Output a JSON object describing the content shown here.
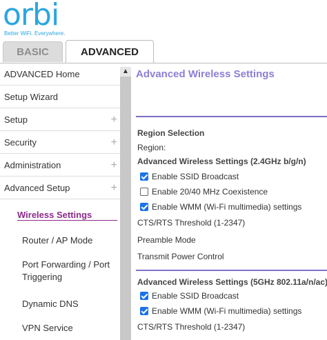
{
  "brand": {
    "name": "orbi",
    "tagline": "Better WiFi. Everywhere.",
    "color": "#2aa6e0"
  },
  "tabs": {
    "basic": "BASIC",
    "advanced": "ADVANCED"
  },
  "sidebar": {
    "items": [
      {
        "label": "ADVANCED Home",
        "icon": "chevron-up"
      },
      {
        "label": "Setup Wizard"
      },
      {
        "label": "Setup",
        "icon": "plus"
      },
      {
        "label": "Security",
        "icon": "plus"
      },
      {
        "label": "Administration",
        "icon": "plus"
      },
      {
        "label": "Advanced Setup",
        "icon": "plus"
      }
    ],
    "sub_items": [
      "Wireless Settings",
      "Router / AP Mode",
      "Port Forwarding / Port Triggering",
      "Dynamic DNS",
      "VPN Service"
    ]
  },
  "content": {
    "title": "Advanced Wireless Settings",
    "region_heading": "Region Selection",
    "region_label": "Region:",
    "section_24": {
      "heading": "Advanced Wireless Settings (2.4GHz b/g/n)",
      "checkboxes": [
        {
          "label": "Enable SSID Broadcast",
          "checked": true
        },
        {
          "label": "Enable 20/40 MHz Coexistence",
          "checked": false
        },
        {
          "label": "Enable WMM (Wi-Fi multimedia) settings",
          "checked": true
        }
      ],
      "cts_label": "CTS/RTS Threshold (1-2347)",
      "preamble_label": "Preamble Mode",
      "power_label": "Transmit Power Control"
    },
    "section_5": {
      "heading": "Advanced Wireless Settings (5GHz 802.11a/n/ac)",
      "checkboxes": [
        {
          "label": "Enable SSID Broadcast",
          "checked": true
        },
        {
          "label": "Enable WMM (Wi-Fi multimedia) settings",
          "checked": true
        }
      ],
      "cts_label": "CTS/RTS Threshold (1-2347)"
    }
  },
  "colors": {
    "accent": "#8b7fd6",
    "active_nav": "#8a2a8a",
    "checkbox": "#1a73e8"
  }
}
